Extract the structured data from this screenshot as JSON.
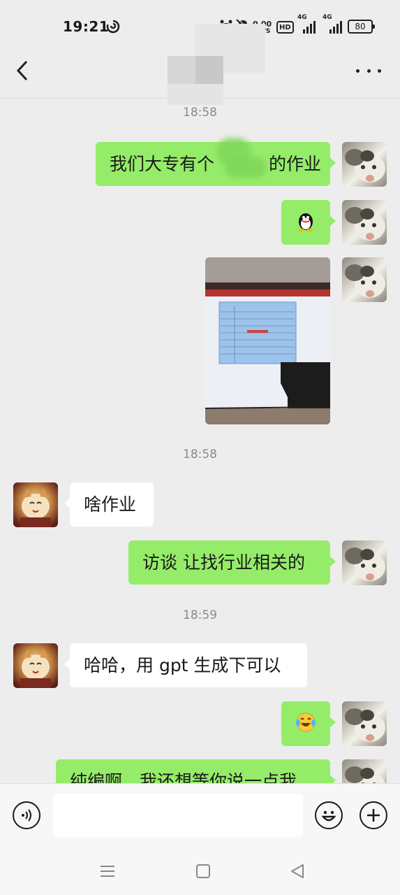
{
  "status_bar": {
    "time": "19:21",
    "speed_value": "0.00",
    "speed_unit": "KB/S",
    "hd_label": "HD",
    "net1": "4G",
    "net2": "4G",
    "battery": "80"
  },
  "header": {
    "back_icon": "chevron-left-icon",
    "more_icon": "more-dots-icon"
  },
  "chat": {
    "timestamps": [
      "18:58",
      "18:58",
      "18:59"
    ],
    "messages": [
      {
        "sender": "me",
        "type": "text",
        "text": "我们大专有个"
      },
      {
        "sender": "me",
        "type": "text",
        "text_after": "的作业"
      },
      {
        "sender": "me",
        "type": "emoji",
        "icon": "qq-penguin-icon"
      },
      {
        "sender": "me",
        "type": "image",
        "icon": "photo-thumbnail"
      },
      {
        "sender": "other",
        "type": "text",
        "text": "啥作业"
      },
      {
        "sender": "me",
        "type": "text",
        "text": "访谈 让找行业相关的"
      },
      {
        "sender": "other",
        "type": "text",
        "text": "哈哈，用 gpt 生成下可以"
      },
      {
        "sender": "me",
        "type": "emoji",
        "icon": "laughing-tears-icon"
      },
      {
        "sender": "me",
        "type": "text",
        "text": "纯编啊，我还想等你说一点我"
      }
    ]
  },
  "input_bar": {
    "voice_icon": "voice-icon",
    "input_value": "",
    "emoji_icon": "smiley-icon",
    "plus_icon": "plus-icon"
  },
  "system_nav": {
    "menu_icon": "menu-icon",
    "home_icon": "home-square-icon",
    "back_icon": "back-triangle-icon"
  },
  "colors": {
    "background": "#ededed",
    "bubble_me": "#95ec69",
    "bubble_other": "#ffffff"
  }
}
